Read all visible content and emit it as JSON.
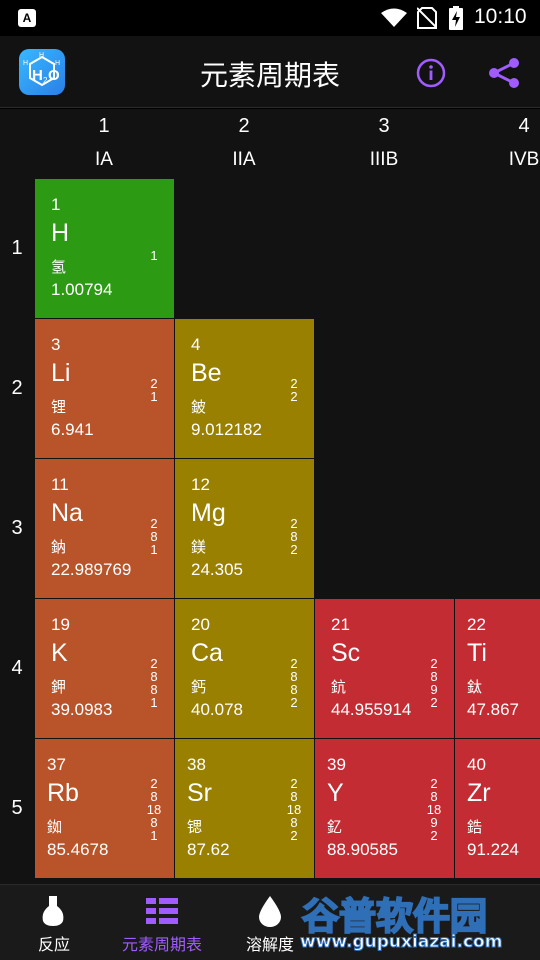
{
  "status_bar": {
    "time": "10:10",
    "notification_icon": "A"
  },
  "app_bar": {
    "title": "元素周期表",
    "logo_icon": "h2o-molecule-icon",
    "info_icon": "info-circle-icon",
    "share_icon": "share-icon",
    "accent_color": "#a05cff"
  },
  "groups": [
    {
      "number": "1",
      "label": "IA"
    },
    {
      "number": "2",
      "label": "IIA"
    },
    {
      "number": "3",
      "label": "IIIB"
    },
    {
      "number": "4",
      "label": "IVB"
    }
  ],
  "periods": [
    "1",
    "2",
    "3",
    "4",
    "5"
  ],
  "elements": [
    {
      "number": "1",
      "symbol": "H",
      "name": "氢",
      "mass": "1.00794",
      "shells": [
        "1"
      ],
      "category_color": "#2d9a14"
    },
    {
      "number": "3",
      "symbol": "Li",
      "name": "锂",
      "mass": "6.941",
      "shells": [
        "2",
        "1"
      ],
      "category_color": "#b9542a"
    },
    {
      "number": "4",
      "symbol": "Be",
      "name": "鈹",
      "mass": "9.012182",
      "shells": [
        "2",
        "2"
      ],
      "category_color": "#998000"
    },
    {
      "number": "11",
      "symbol": "Na",
      "name": "鈉",
      "mass": "22.989769",
      "shells": [
        "2",
        "8",
        "1"
      ],
      "category_color": "#b9542a"
    },
    {
      "number": "12",
      "symbol": "Mg",
      "name": "鎂",
      "mass": "24.305",
      "shells": [
        "2",
        "8",
        "2"
      ],
      "category_color": "#998000"
    },
    {
      "number": "19",
      "symbol": "K",
      "name": "鉀",
      "mass": "39.0983",
      "shells": [
        "2",
        "8",
        "8",
        "1"
      ],
      "category_color": "#b9542a"
    },
    {
      "number": "20",
      "symbol": "Ca",
      "name": "鈣",
      "mass": "40.078",
      "shells": [
        "2",
        "8",
        "8",
        "2"
      ],
      "category_color": "#998000"
    },
    {
      "number": "21",
      "symbol": "Sc",
      "name": "鈧",
      "mass": "44.955914",
      "shells": [
        "2",
        "8",
        "9",
        "2"
      ],
      "category_color": "#c42c33"
    },
    {
      "number": "22",
      "symbol": "Ti",
      "name": "鈦",
      "mass": "47.867",
      "shells": [],
      "category_color": "#c42c33"
    },
    {
      "number": "37",
      "symbol": "Rb",
      "name": "銣",
      "mass": "85.4678",
      "shells": [
        "2",
        "8",
        "18",
        "8",
        "1"
      ],
      "category_color": "#b9542a"
    },
    {
      "number": "38",
      "symbol": "Sr",
      "name": "锶",
      "mass": "87.62",
      "shells": [
        "2",
        "8",
        "18",
        "8",
        "2"
      ],
      "category_color": "#998000"
    },
    {
      "number": "39",
      "symbol": "Y",
      "name": "釔",
      "mass": "88.90585",
      "shells": [
        "2",
        "8",
        "18",
        "9",
        "2"
      ],
      "category_color": "#c42c33"
    },
    {
      "number": "40",
      "symbol": "Zr",
      "name": "鋯",
      "mass": "91.224",
      "shells": [],
      "category_color": "#c42c33"
    }
  ],
  "bottom_nav": {
    "items": [
      {
        "label": "反应",
        "icon": "flask-icon",
        "active": false
      },
      {
        "label": "元素周期表",
        "icon": "grid-table-icon",
        "active": true
      },
      {
        "label": "溶解度",
        "icon": "drop-icon",
        "active": false
      }
    ],
    "active_color": "#a05cff",
    "inactive_color": "#ffffff"
  },
  "watermark": {
    "title": "谷普软件园",
    "url": "www.gupuxiazai.com"
  }
}
